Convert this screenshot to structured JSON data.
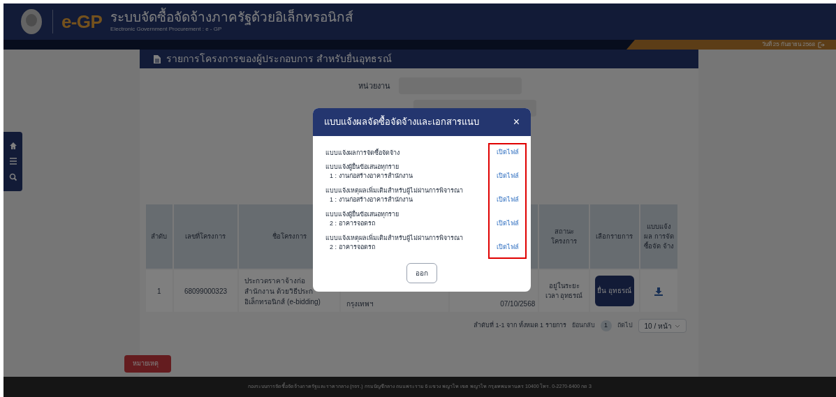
{
  "header": {
    "logo": "e-GP",
    "title": "ระบบจัดซื้อจัดจ้างภาครัฐด้วยอิเล็กทรอนิกส์",
    "subtitle": "Electronic Government Procurement : e - GP",
    "date": "วันที่ 25 กันยายน 2568"
  },
  "page_title": "รายการโครงการของผู้ประกอบการ สำหรับยื่นอุทธรณ์",
  "form": {
    "label": "หน่วยงาน"
  },
  "table": {
    "columns": [
      "ลำดับ",
      "เลขที่โครงการ",
      "ชื่อโครงการ",
      "",
      "",
      "สถานะ โครงการ",
      "เลือกรายการ",
      "แบบแจ้ง ผล การจัด ซื้อจัด จ้าง"
    ],
    "rows": [
      {
        "no": "1",
        "project_no": "68099000323",
        "name_lines": [
          "ประกวดราคาจ้างก่อ",
          "สำนักงาน ด้วยวิธีประก",
          "อิเล็กทรอนิกส์ (e-bidding)"
        ],
        "agency": "กรุงเทพฯ",
        "date": "07/10/2568",
        "status": "อยู่ในระยะเวลา อุทธรณ์",
        "action": "ยื่น อุทธรณ์"
      }
    ]
  },
  "pagination": {
    "summary": "ลำดับที่ 1-1 จาก ทั้งหมด 1 รายการ",
    "prev": "ย้อนกลับ",
    "page": "1",
    "next": "ถัดไป",
    "page_size": "10 / หน้า"
  },
  "remark_tab": "หมายเหตุ",
  "footer": "กองระบบการจัดซื้อจัดจ้างภาครัฐและราคากลาง (กจร.) กรมบัญชีกลาง ถนนพระราม 6 แขวง พญาไท เขต พญาไท กรุงเทพมหานคร 10400 โทร. 0-2270-6400 กด 3",
  "modal": {
    "title": "แบบแจ้งผลจัดซื้อจัดจ้างและเอกสารแนบ",
    "close": "×",
    "items": [
      {
        "title": "แบบแจ้งผลการจัดซื้อจัดจ้าง",
        "link": "เปิดไฟล์"
      },
      {
        "title": "แบบแจ้งผู้ยื่นข้อเสนอทุกราย",
        "sub": "1 : งานก่อสร้างอาคารสำนักงาน",
        "link": "เปิดไฟล์"
      },
      {
        "title": "แบบแจ้งเหตุผลเพิ่มเติมสำหรับผู้ไม่ผ่านการพิจารณา",
        "sub": "1 : งานก่อสร้างอาคารสำนักงาน",
        "link": "เปิดไฟล์"
      },
      {
        "title": "แบบแจ้งผู้ยื่นข้อเสนอทุกราย",
        "sub": "2 : อาคารจอดรถ",
        "link": "เปิดไฟล์"
      },
      {
        "title": "แบบแจ้งเหตุผลเพิ่มเติมสำหรับผู้ไม่ผ่านการพิจารณา",
        "sub": "2 : อาคารจอดรถ",
        "link": "เปิดไฟล์"
      }
    ],
    "button": "ออก"
  }
}
